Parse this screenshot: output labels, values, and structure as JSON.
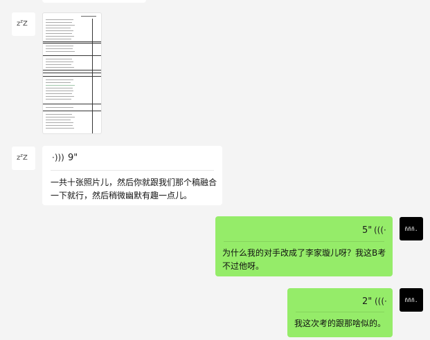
{
  "messages": [
    {
      "side": "left",
      "type": "image"
    },
    {
      "side": "left",
      "type": "voice",
      "duration": "9\"",
      "transcript": "一共十张照片儿，然后你就跟我们那个稿融合一下就行，然后稍微幽默有趣一点儿。"
    },
    {
      "side": "right",
      "type": "voice",
      "duration": "5\"",
      "transcript": "为什么我的对手改成了李家璇儿呀？我这B考不过他呀。"
    },
    {
      "side": "right",
      "type": "voice",
      "duration": "2\"",
      "transcript": "我这次考的跟那啥似的。"
    }
  ],
  "avatars": {
    "left_label": "zzZ",
    "right_label": "ñññ."
  },
  "colors": {
    "background": "#f4f4f4",
    "incoming": "#ffffff",
    "outgoing": "#95ec69"
  }
}
